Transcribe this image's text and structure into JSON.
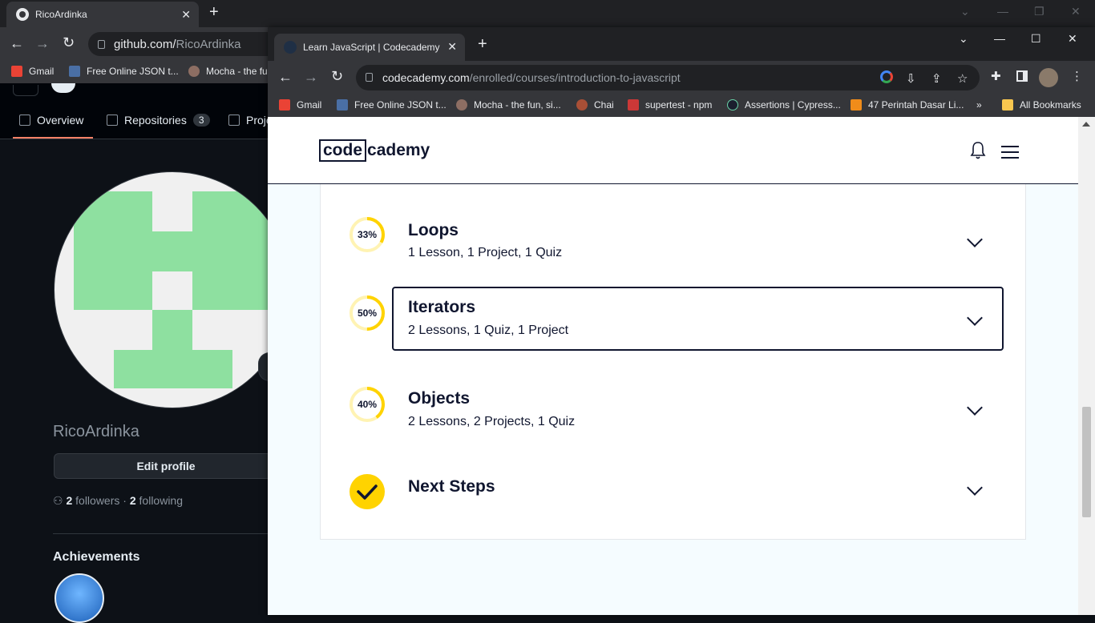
{
  "back_window": {
    "tab_title": "RicoArdinka",
    "url_domain": "github.com/",
    "url_path": "RicoArdinka",
    "bookmarks": [
      "Gmail",
      "Free Online JSON t...",
      "Mocha - the fu"
    ],
    "nav_tabs": {
      "overview": "Overview",
      "repositories": "Repositories",
      "repositories_count": "3",
      "projects": "Proje"
    },
    "username": "RicoArdinka",
    "edit_profile": "Edit profile",
    "followers_count": "2",
    "followers_label": "followers",
    "sep": "·",
    "following_count": "2",
    "following_label": "following",
    "achievements": "Achievements"
  },
  "front_window": {
    "tab_title": "Learn JavaScript | Codecademy",
    "url_domain": "codecademy.com",
    "url_path": "/enrolled/courses/introduction-to-javascript",
    "bookmarks": [
      "Gmail",
      "Free Online JSON t...",
      "Mocha - the fun, si...",
      "Chai",
      "supertest - npm",
      "Assertions | Cypress...",
      "47 Perintah Dasar Li...",
      "»",
      "All Bookmarks"
    ]
  },
  "codecademy": {
    "logo_box": "code",
    "logo_rest": "cademy",
    "modules": [
      {
        "progress": "33%",
        "progress_value": 0.33,
        "title": "Loops",
        "subtitle": "1 Lesson, 1 Project, 1 Quiz"
      },
      {
        "progress": "50%",
        "progress_value": 0.5,
        "title": "Iterators",
        "subtitle": "2 Lessons, 1 Quiz, 1 Project"
      },
      {
        "progress": "40%",
        "progress_value": 0.4,
        "title": "Objects",
        "subtitle": "2 Lessons, 2 Projects, 1 Quiz"
      },
      {
        "progress_value": 1.0,
        "title": "Next Steps"
      }
    ]
  },
  "colors": {
    "accent": "#ffd300",
    "track": "#fff3b3",
    "navy": "#10162f"
  }
}
